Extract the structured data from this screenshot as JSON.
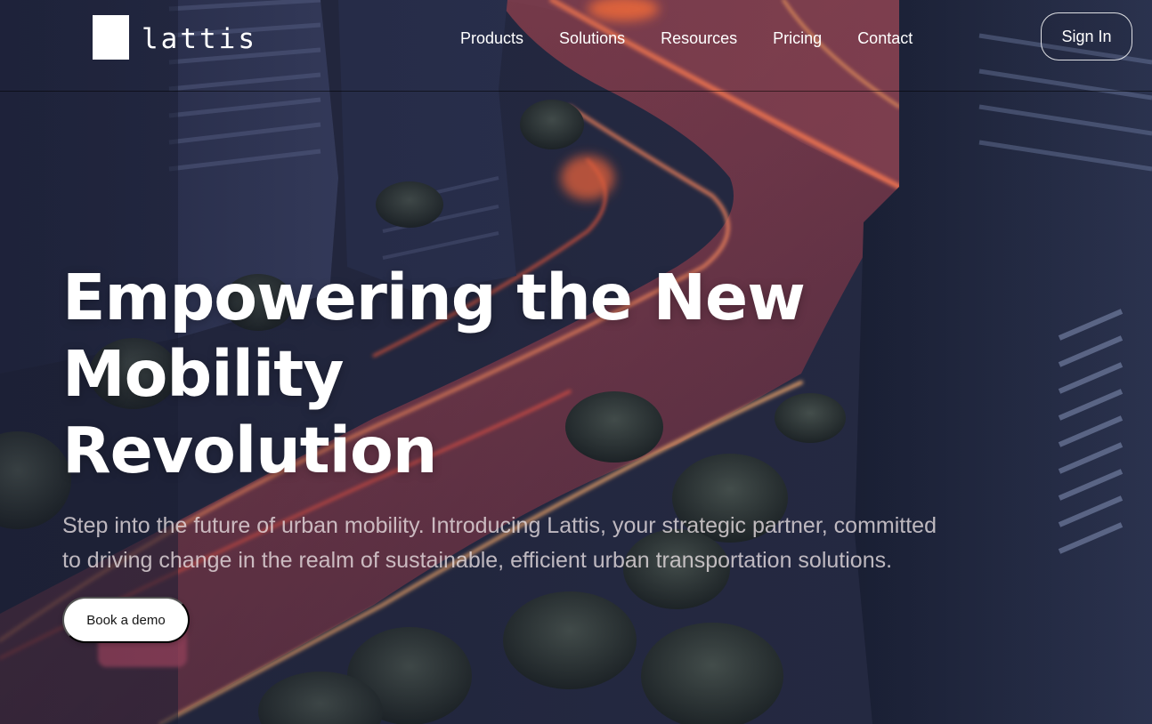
{
  "brand": {
    "name": "lattis"
  },
  "nav": {
    "items": [
      {
        "label": "Products"
      },
      {
        "label": "Solutions"
      },
      {
        "label": "Resources"
      },
      {
        "label": "Pricing"
      },
      {
        "label": "Contact"
      }
    ],
    "sign_in_label": "Sign In"
  },
  "hero": {
    "title_line1": "Empowering the New Mobility",
    "title_line2": "Revolution",
    "subtitle": "Step into the future of urban mobility. Introducing Lattis, your strategic partner, committed to driving change in the realm of sustainable, efficient urban transportation solutions.",
    "cta_label": "Book a demo",
    "background_image": "aerial-city-street-neon-light-trails"
  },
  "colors": {
    "dark_navy": "#1d2236",
    "road_red": "#7a3a4a",
    "light_trail": "#ff6a4a",
    "white": "#ffffff"
  }
}
